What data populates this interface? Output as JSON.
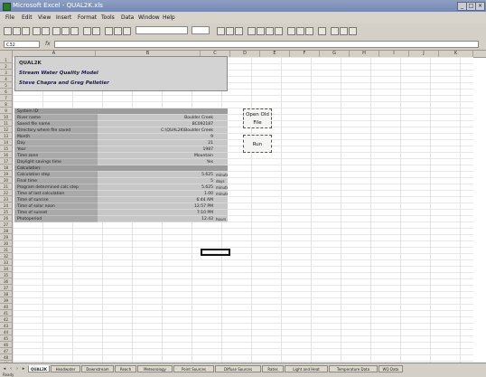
{
  "window": {
    "title": "Microsoft Excel - QUAL2K.xls"
  },
  "menu": [
    "File",
    "Edit",
    "View",
    "Insert",
    "Format",
    "Tools",
    "Data",
    "Window",
    "Help"
  ],
  "formula_bar": {
    "name_box": "C32",
    "fx": "fx"
  },
  "banner": {
    "line1": "QUAL2K",
    "line2": "Stream Water Quality Model",
    "line3": "Steve Chapra and Greg Pelletier"
  },
  "parameters": [
    {
      "label": "System ID:",
      "value": "",
      "unit": ""
    },
    {
      "label": "River name",
      "value": "Boulder Creek",
      "unit": ""
    },
    {
      "label": "Saved file name",
      "value": "BC092187",
      "unit": ""
    },
    {
      "label": "Directory where file saved",
      "value": "C:\\QUAL2K\\Boulder Creek",
      "unit": ""
    },
    {
      "label": "Month",
      "value": "9",
      "unit": ""
    },
    {
      "label": "Day",
      "value": "21",
      "unit": ""
    },
    {
      "label": "Year",
      "value": "1987",
      "unit": ""
    },
    {
      "label": "Time zone",
      "value": "Mountain",
      "unit": ""
    },
    {
      "label": "Daylight savings time",
      "value": "Yes",
      "unit": ""
    },
    {
      "label": "Calculation:",
      "value": "",
      "unit": ""
    },
    {
      "label": "Calculation step",
      "value": "5.625",
      "unit": "minutes"
    },
    {
      "label": "Final time",
      "value": "5",
      "unit": "days"
    },
    {
      "label": "Program determined calc step",
      "value": "5.625",
      "unit": "minutes"
    },
    {
      "label": "Time of last calculation",
      "value": "1.00",
      "unit": "minutes"
    },
    {
      "label": "Time of sunrise",
      "value": "6:44 AM",
      "unit": ""
    },
    {
      "label": "Time of solar noon",
      "value": "12:57 PM",
      "unit": ""
    },
    {
      "label": "Time of sunset",
      "value": "7:10 PM",
      "unit": ""
    },
    {
      "label": "Photoperiod",
      "value": "12.43",
      "unit": "hours"
    }
  ],
  "buttons": {
    "open_old_file": "Open Old File",
    "run": "Run"
  },
  "tabs": [
    "QUAL2K",
    "Headwater",
    "Downstream",
    "Reach",
    "Meteorology",
    "Point Sources",
    "Diffuse Sources",
    "Rates",
    "Light and Heat",
    "Temperature Data",
    "WQ Data"
  ],
  "status": "Ready"
}
